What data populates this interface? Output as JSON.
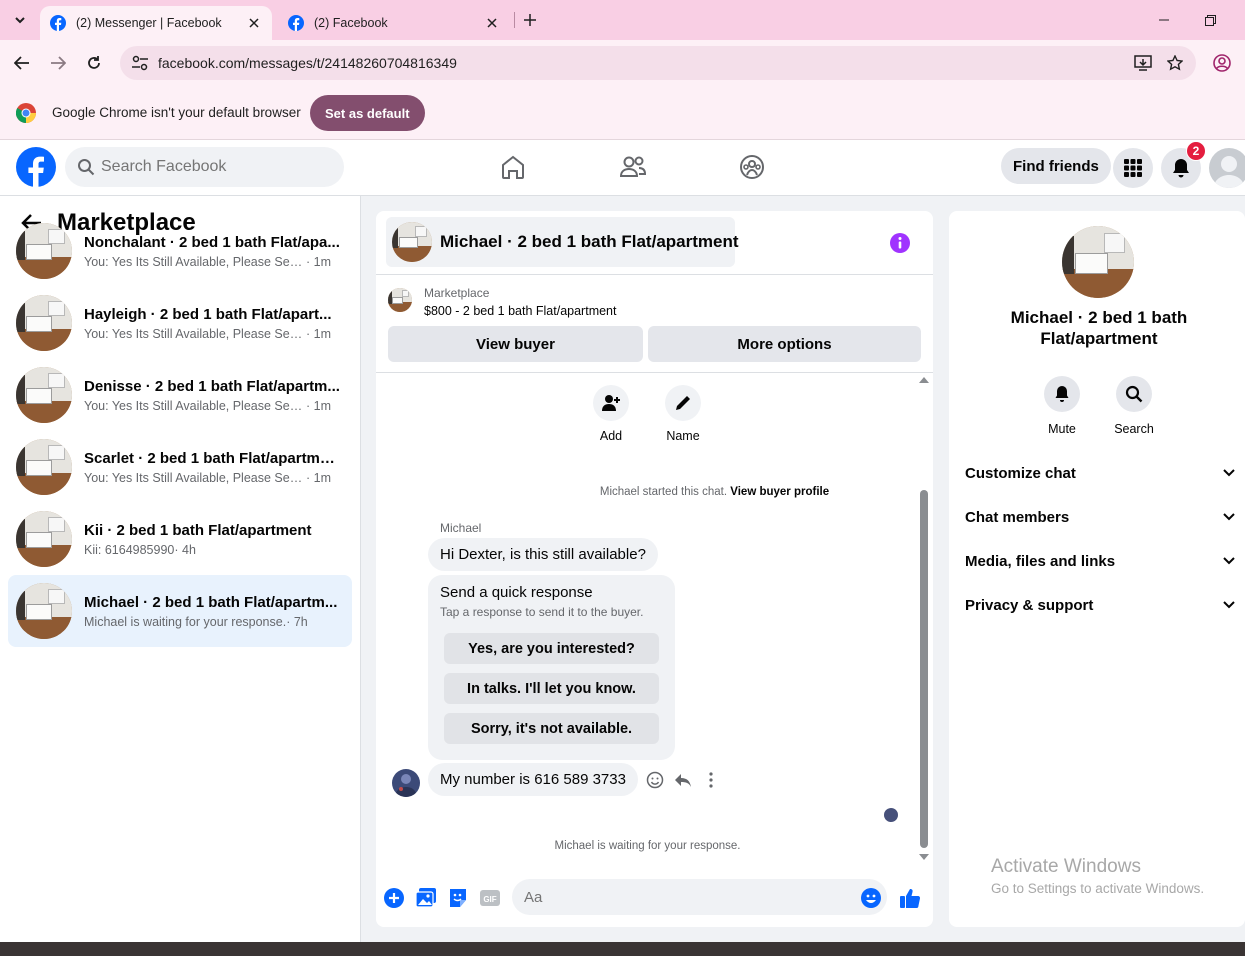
{
  "browser": {
    "tabs": [
      {
        "label": "(2) Messenger | Facebook",
        "active": true
      },
      {
        "label": "(2) Facebook",
        "active": false
      }
    ],
    "url": "facebook.com/messages/t/24148260704816349",
    "infobar_message": "Google Chrome isn't your default browser",
    "infobar_button": "Set as default"
  },
  "header": {
    "search_placeholder": "Search Facebook",
    "find_friends": "Find friends",
    "notification_count": "2"
  },
  "sidebar": {
    "title": "Marketplace",
    "conversations": [
      {
        "name": "Nonchalant · 2 bed 1 bath Flat/apa...",
        "preview": "You: Yes Its Still Available, Please Sen...",
        "time": " · 1m",
        "selected": false
      },
      {
        "name": "Hayleigh · 2 bed 1 bath Flat/apart...",
        "preview": "You: Yes Its Still Available, Please Sen...",
        "time": " · 1m",
        "selected": false
      },
      {
        "name": "Denisse · 2 bed 1 bath Flat/apartm...",
        "preview": "You: Yes Its Still Available, Please Sen...",
        "time": " · 1m",
        "selected": false
      },
      {
        "name": "Scarlet · 2 bed 1 bath Flat/apartment",
        "preview": "You: Yes Its Still Available, Please Sen...",
        "time": " · 1m",
        "selected": false
      },
      {
        "name": "Kii · 2 bed 1 bath Flat/apartment",
        "preview": "Kii: 6164985990",
        "time": " · 4h",
        "selected": false
      },
      {
        "name": "Michael · 2 bed 1 bath Flat/apartm...",
        "preview": "Michael is waiting for your response.",
        "time": " · 7h",
        "selected": true
      }
    ]
  },
  "chat": {
    "title": "Michael · 2 bed 1 bath Flat/apartment",
    "marketplace_label": "Marketplace",
    "listing": "$800 - 2 bed 1 bath Flat/apartment",
    "view_buyer": "View buyer",
    "more_options": "More options",
    "add_label": "Add",
    "name_label": "Name",
    "started_text": "Michael started this chat.",
    "view_buyer_profile": "View buyer profile",
    "sender_name": "Michael",
    "first_message": "Hi Dexter, is this still available?",
    "quick_title": "Send a quick response",
    "quick_sub": "Tap a response to send it to the buyer.",
    "quick_replies": [
      "Yes, are you interested?",
      "In talks. I'll let you know.",
      "Sorry, it's not available."
    ],
    "second_message": "My number is 616 589 3733",
    "waiting": "Michael is waiting for your response.",
    "input_placeholder": "Aa"
  },
  "right_panel": {
    "name_line1": "Michael · 2 bed 1 bath",
    "name_line2": "Flat/apartment",
    "mute": "Mute",
    "search": "Search",
    "sections": [
      "Customize chat",
      "Chat members",
      "Media, files and links",
      "Privacy & support"
    ]
  },
  "watermark": {
    "line1": "Activate Windows",
    "line2": "Go to Settings to activate Windows."
  },
  "colors": {
    "facebook_blue": "#0866ff",
    "infobar_button": "#834e6e",
    "tabstrip": "#f9cfe4",
    "selected_convo": "#e8f2fd",
    "info_purple": "#a033ff",
    "badge_red": "#e41e3f"
  }
}
